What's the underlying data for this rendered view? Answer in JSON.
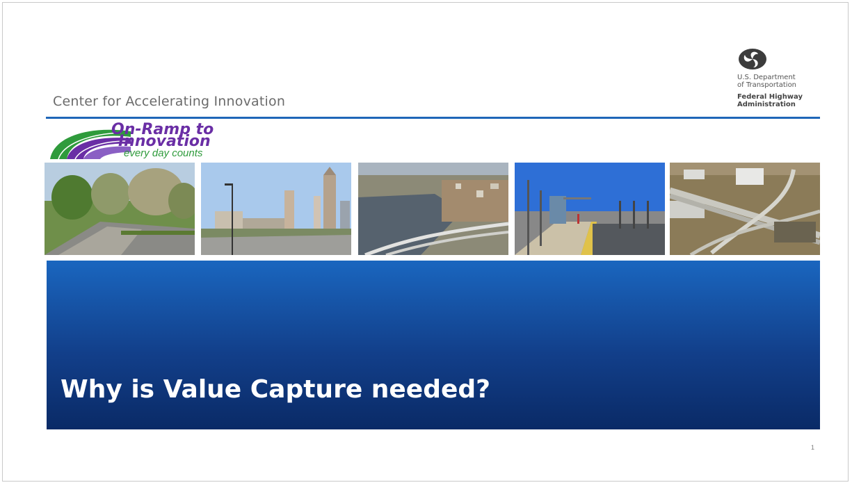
{
  "header": {
    "title": "Center for Accelerating Innovation"
  },
  "dot_logo": {
    "line1": "U.S. Department",
    "line2": "of Transportation",
    "line3": "Federal Highway",
    "line4": "Administration",
    "icon": "dot-triskelion-icon"
  },
  "program_logo": {
    "line1": "On-Ramp to",
    "line2": "Innovation",
    "line3": "every day counts",
    "icon": "road-swoosh-icon"
  },
  "photos": [
    {
      "name": "tree-lined-street-photo"
    },
    {
      "name": "city-skyline-photo"
    },
    {
      "name": "river-bridge-aerial-photo"
    },
    {
      "name": "transit-platform-photo"
    },
    {
      "name": "highway-interchange-aerial-photo"
    }
  ],
  "banner": {
    "title": "Why is Value Capture needed?"
  },
  "footer": {
    "page_number": "1"
  },
  "colors": {
    "rule": "#1f66b8",
    "banner_top": "#1a66bf",
    "banner_bottom": "#0a2a66",
    "logo_purple": "#6a2ea5",
    "logo_green": "#2f9b3c"
  }
}
